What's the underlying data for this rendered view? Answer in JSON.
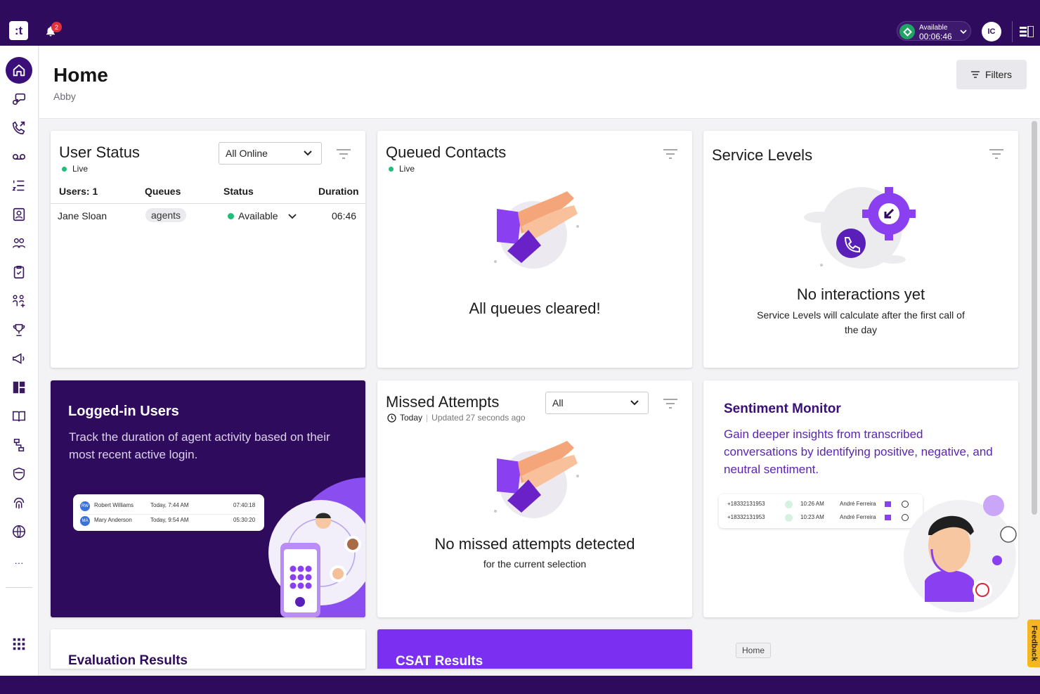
{
  "topbar": {
    "logo": ":t",
    "notifications_count": "2",
    "status_label": "Available",
    "status_timer": "00:06:46",
    "user_initials": "IC"
  },
  "sidebar": {
    "items": [
      "home-icon",
      "conversations-icon",
      "calls-icon",
      "voicemail-icon",
      "queue-list-icon",
      "contacts-icon",
      "teams-icon",
      "tasks-icon",
      "users-icon",
      "trophy-icon",
      "campaigns-icon",
      "dashboard-icon",
      "knowledge-icon",
      "workflow-icon",
      "security-icon",
      "fingerprint-icon",
      "globe-icon"
    ],
    "more": "···"
  },
  "header": {
    "title": "Home",
    "subtitle": "Abby",
    "filters_label": "Filters"
  },
  "user_status": {
    "title": "User Status",
    "live": "Live",
    "dropdown_value": "All Online",
    "columns": [
      "Users: 1",
      "Queues",
      "Status",
      "Duration"
    ],
    "rows": [
      {
        "name": "Jane Sloan",
        "queue": "agents",
        "status": "Available",
        "duration": "06:46"
      }
    ]
  },
  "queued_contacts": {
    "title": "Queued Contacts",
    "live": "Live",
    "message": "All queues cleared!"
  },
  "service_levels": {
    "title": "Service Levels",
    "message": "No interactions yet",
    "detail": "Service Levels will calculate after the first call of the day"
  },
  "logged_in": {
    "title": "Logged-in Users",
    "body": "Track the duration of agent activity based on their most recent active login.",
    "rows": [
      {
        "initials": "RW",
        "name": "Robert Williams",
        "time": "Today, 7:44 AM",
        "duration": "07:40:18"
      },
      {
        "initials": "MA",
        "name": "Mary Anderson",
        "time": "Today, 9:54 AM",
        "duration": "05:30:20"
      }
    ]
  },
  "missed_attempts": {
    "title": "Missed Attempts",
    "dropdown_value": "All",
    "today": "Today",
    "updated": "Updated 27 seconds ago",
    "message": "No missed attempts detected",
    "detail": "for the current selection"
  },
  "sentiment": {
    "title": "Sentiment Monitor",
    "body": "Gain deeper insights from transcribed conversations by identifying positive, negative, and neutral sentiment.",
    "rows": [
      {
        "number": "+18332131953",
        "time": "10:26 AM",
        "agent": "André Ferreira"
      },
      {
        "number": "+18332131953",
        "time": "10:23 AM",
        "agent": "André Ferreira"
      }
    ]
  },
  "bottom_cards": {
    "evaluation_title": "Evaluation Results",
    "csat_title": "CSAT Results"
  },
  "tooltip": "Home",
  "feedback": "Feedback",
  "colors": {
    "brand_dark": "#2e0b5c",
    "accent_purple": "#7b2ff0",
    "live_green": "#1fbf7a"
  }
}
